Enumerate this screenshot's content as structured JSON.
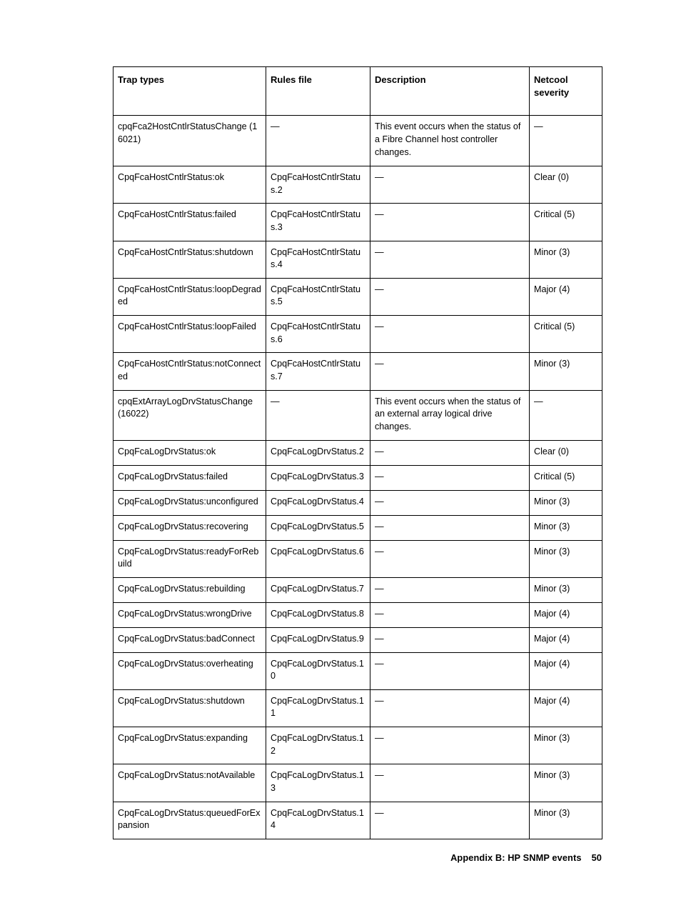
{
  "table": {
    "columns": [
      "Trap types",
      "Rules file",
      "Description",
      "Netcool severity"
    ],
    "rows": [
      {
        "trap": "cpqFca2HostCntlrStatusChange (16021)",
        "rules": "—",
        "description": "This event occurs when the status of a Fibre Channel host controller changes.",
        "severity": "—"
      },
      {
        "trap": "CpqFcaHostCntlrStatus:ok",
        "rules": "CpqFcaHostCntlrStatus.2",
        "description": "—",
        "severity": "Clear (0)"
      },
      {
        "trap": "CpqFcaHostCntlrStatus:failed",
        "rules": "CpqFcaHostCntlrStatus.3",
        "description": "—",
        "severity": "Critical (5)"
      },
      {
        "trap": "CpqFcaHostCntlrStatus:shutdown",
        "rules": "CpqFcaHostCntlrStatus.4",
        "description": "—",
        "severity": "Minor (3)"
      },
      {
        "trap": "CpqFcaHostCntlrStatus:loopDegraded",
        "rules": "CpqFcaHostCntlrStatus.5",
        "description": "—",
        "severity": "Major (4)"
      },
      {
        "trap": "CpqFcaHostCntlrStatus:loopFailed",
        "rules": "CpqFcaHostCntlrStatus.6",
        "description": "—",
        "severity": "Critical (5)"
      },
      {
        "trap": "CpqFcaHostCntlrStatus:notConnected",
        "rules": "CpqFcaHostCntlrStatus.7",
        "description": "—",
        "severity": "Minor (3)"
      },
      {
        "trap": "cpqExtArrayLogDrvStatusChange (16022)",
        "rules": "—",
        "description": "This event occurs when the status of an external array logical drive changes.",
        "severity": "—"
      },
      {
        "trap": "CpqFcaLogDrvStatus:ok",
        "rules": "CpqFcaLogDrvStatus.2",
        "description": "—",
        "severity": "Clear (0)"
      },
      {
        "trap": "CpqFcaLogDrvStatus:failed",
        "rules": "CpqFcaLogDrvStatus.3",
        "description": "—",
        "severity": "Critical (5)"
      },
      {
        "trap": "CpqFcaLogDrvStatus:unconfigured",
        "rules": "CpqFcaLogDrvStatus.4",
        "description": "—",
        "severity": "Minor (3)"
      },
      {
        "trap": "CpqFcaLogDrvStatus:recovering",
        "rules": "CpqFcaLogDrvStatus.5",
        "description": "—",
        "severity": "Minor (3)"
      },
      {
        "trap": "CpqFcaLogDrvStatus:readyForRebuild",
        "rules": "CpqFcaLogDrvStatus.6",
        "description": "—",
        "severity": "Minor (3)"
      },
      {
        "trap": "CpqFcaLogDrvStatus:rebuilding",
        "rules": "CpqFcaLogDrvStatus.7",
        "description": "—",
        "severity": "Minor (3)"
      },
      {
        "trap": "CpqFcaLogDrvStatus:wrongDrive",
        "rules": "CpqFcaLogDrvStatus.8",
        "description": "—",
        "severity": "Major (4)"
      },
      {
        "trap": "CpqFcaLogDrvStatus:badConnect",
        "rules": "CpqFcaLogDrvStatus.9",
        "description": "—",
        "severity": "Major (4)"
      },
      {
        "trap": "CpqFcaLogDrvStatus:overheating",
        "rules": "CpqFcaLogDrvStatus.10",
        "description": "—",
        "severity": "Major (4)"
      },
      {
        "trap": "CpqFcaLogDrvStatus:shutdown",
        "rules": "CpqFcaLogDrvStatus.11",
        "description": "—",
        "severity": "Major (4)"
      },
      {
        "trap": "CpqFcaLogDrvStatus:expanding",
        "rules": "CpqFcaLogDrvStatus.12",
        "description": "—",
        "severity": "Minor (3)"
      },
      {
        "trap": "CpqFcaLogDrvStatus:notAvailable",
        "rules": "CpqFcaLogDrvStatus.13",
        "description": "—",
        "severity": "Minor (3)"
      },
      {
        "trap": "CpqFcaLogDrvStatus:queuedForExpansion",
        "rules": "CpqFcaLogDrvStatus.14",
        "description": "—",
        "severity": "Minor (3)"
      }
    ]
  },
  "footer": {
    "appendix_label": "Appendix B: HP SNMP events",
    "page_number": "50"
  }
}
